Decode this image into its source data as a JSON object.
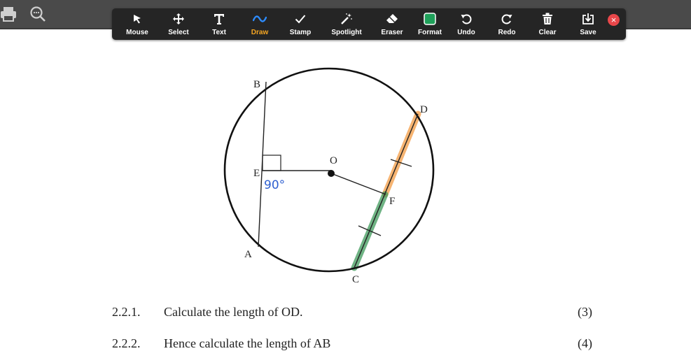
{
  "toolbar": {
    "tools": [
      {
        "label": "Mouse",
        "icon": "cursor-arrow-icon"
      },
      {
        "label": "Select",
        "icon": "move-arrows-icon"
      },
      {
        "label": "Text",
        "icon": "text-t-icon"
      },
      {
        "label": "Draw",
        "icon": "squiggle-icon",
        "active": true
      },
      {
        "label": "Stamp",
        "icon": "checkmark-icon"
      },
      {
        "label": "Spotlight",
        "icon": "magic-wand-icon"
      },
      {
        "label": "Eraser",
        "icon": "eraser-icon"
      },
      {
        "label": "Format",
        "icon": "color-square-icon"
      },
      {
        "label": "Undo",
        "icon": "undo-icon"
      },
      {
        "label": "Redo",
        "icon": "redo-icon"
      },
      {
        "label": "Clear",
        "icon": "trash-icon"
      },
      {
        "label": "Save",
        "icon": "save-download-icon"
      }
    ],
    "close_glyph": "×",
    "format_color": "#1fa05a",
    "active_color": "#f5a623",
    "draw_color": "#2d8cff"
  },
  "left_tools": [
    "print-icon",
    "zoom-icon"
  ],
  "diagram": {
    "points": {
      "B": "B",
      "D": "D",
      "O": "O",
      "E": "E",
      "F": "F",
      "A": "A",
      "C": "C"
    },
    "angle_annotation": "90°",
    "highlight_orange": "#f4a250",
    "highlight_green": "#3f9a5c"
  },
  "questions": [
    {
      "number": "2.2.1.",
      "text": "Calculate the length of OD.",
      "marks": "(3)"
    },
    {
      "number": "2.2.2.",
      "text": "Hence calculate the length of AB",
      "marks": "(4)"
    }
  ]
}
